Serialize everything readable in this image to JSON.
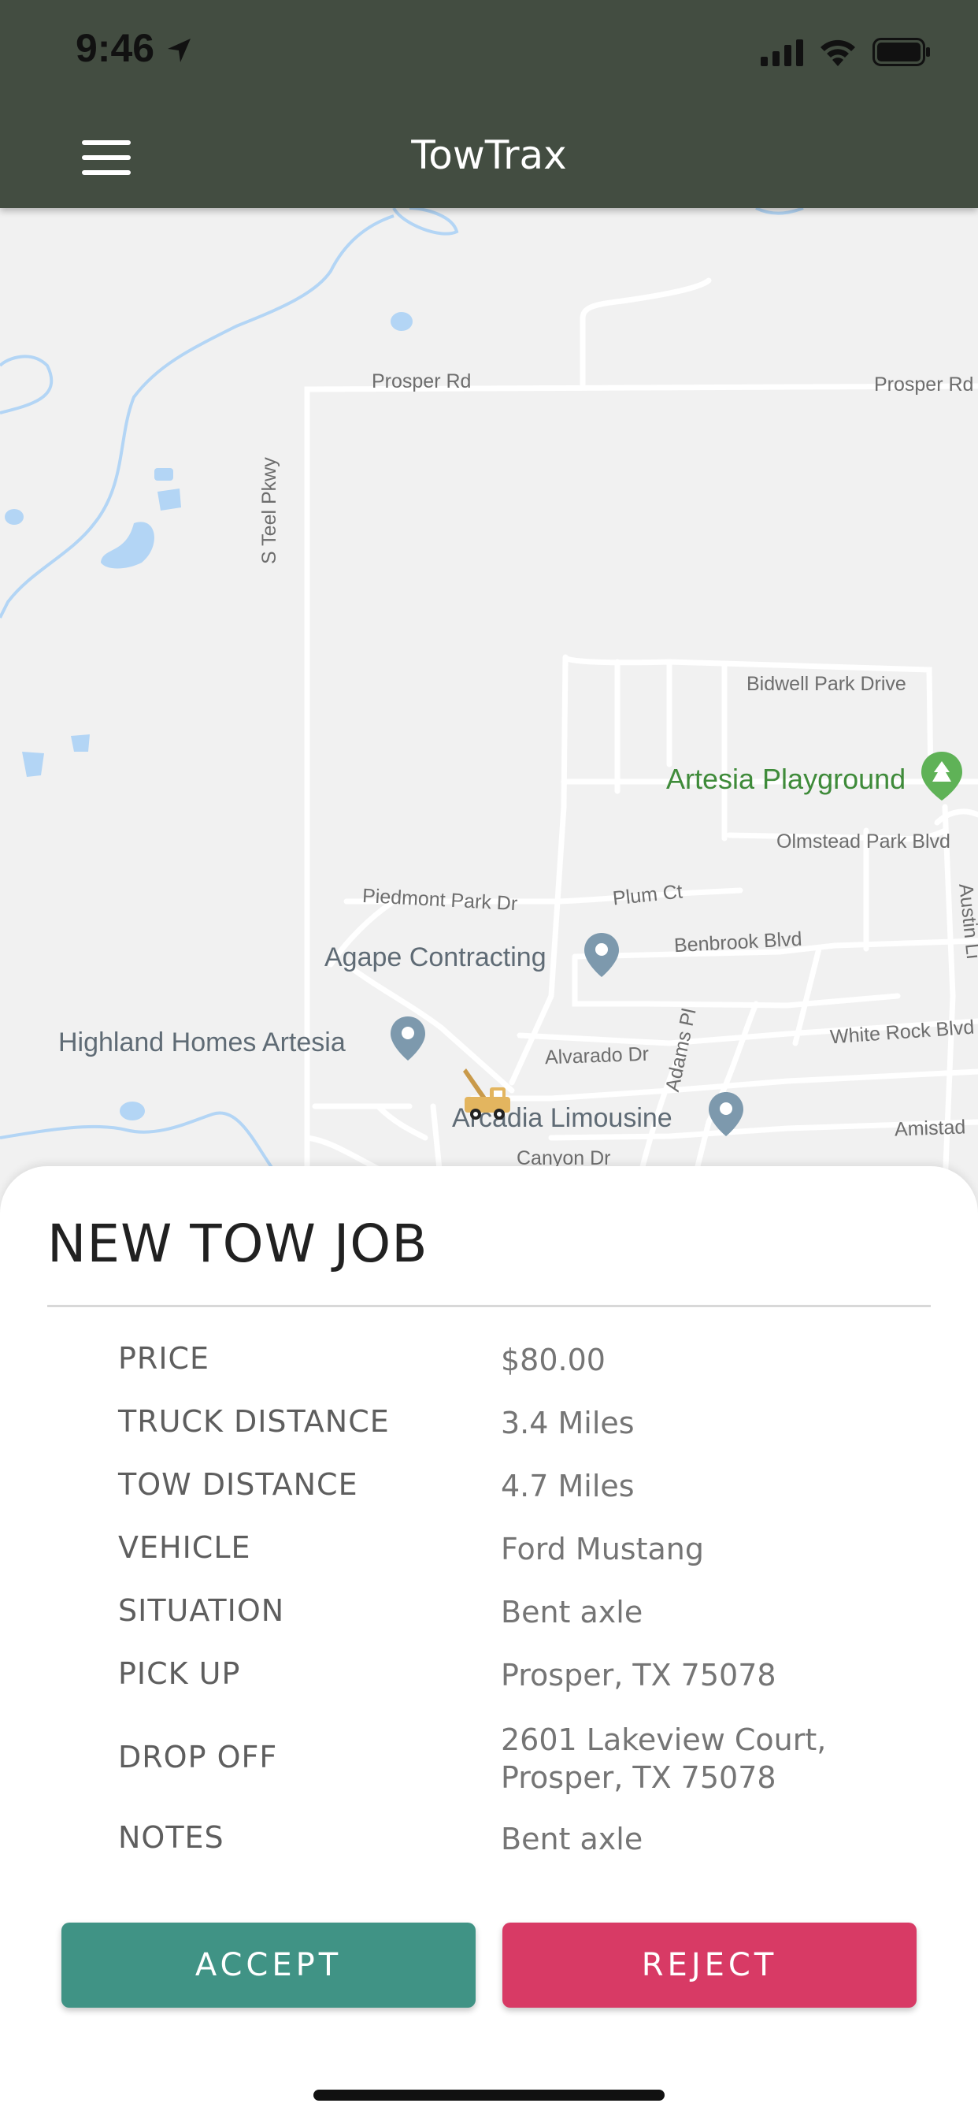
{
  "status_bar": {
    "time": "9:46"
  },
  "header": {
    "title": "TowTrax",
    "menu_icon": "hamburger-menu-icon"
  },
  "map": {
    "roads": [
      "Prosper Rd",
      "Prosper Rd",
      "S Teel Pkwy",
      "Bidwell Park Drive",
      "Olmstead Park Blvd",
      "Piedmont Park Dr",
      "Plum Ct",
      "Benbrook Blvd",
      "Alvarado Dr",
      "Adams Pl",
      "White Rock Blvd",
      "Amistad",
      "Canyon Dr",
      "Austin Li"
    ],
    "places": {
      "park": "Artesia Playground",
      "poi_1": "Agape Contracting",
      "poi_2": "Highland Homes Artesia",
      "poi_3": "Arcadia Limousine"
    },
    "colors": {
      "water": "#b3d5f5",
      "park": "#3f8b3a",
      "pin": "#7d99ad",
      "road": "#ffffff"
    }
  },
  "job": {
    "title": "NEW TOW JOB",
    "fields": [
      {
        "label": "PRICE",
        "value": "$80.00"
      },
      {
        "label": "TRUCK DISTANCE",
        "value": "3.4 Miles"
      },
      {
        "label": "TOW DISTANCE",
        "value": "4.7 Miles"
      },
      {
        "label": "VEHICLE",
        "value": "Ford Mustang"
      },
      {
        "label": "SITUATION",
        "value": "Bent axle"
      },
      {
        "label": "PICK UP",
        "value": "Prosper, TX 75078"
      },
      {
        "label": "DROP OFF",
        "value": "2601 Lakeview Court,",
        "value_line2": "Prosper, TX 75078"
      },
      {
        "label": "NOTES",
        "value": "Bent axle"
      }
    ],
    "accept_label": "ACCEPT",
    "reject_label": "REJECT",
    "colors": {
      "accept": "#409385",
      "reject": "#d83a65"
    }
  }
}
